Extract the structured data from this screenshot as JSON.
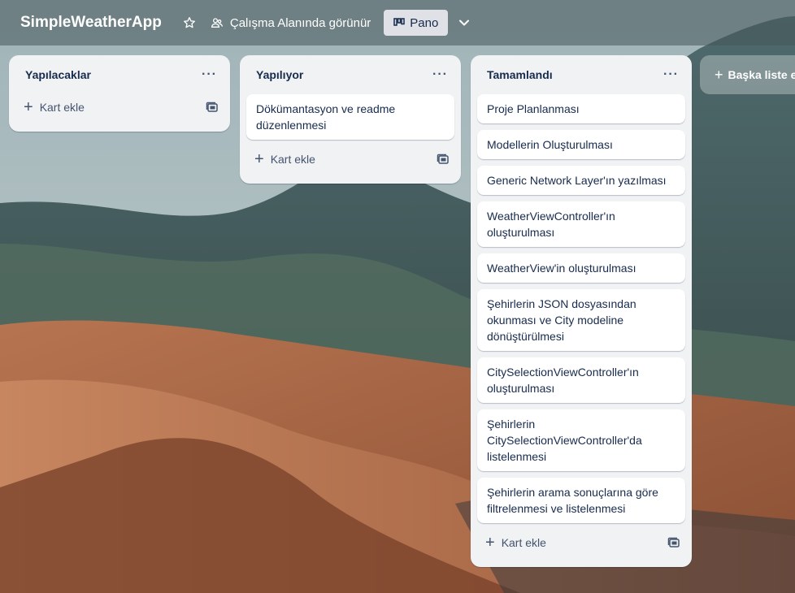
{
  "header": {
    "board_title": "SimpleWeatherApp",
    "visibility_label": "Çalışma Alanında görünür",
    "view_label": "Pano"
  },
  "lists": [
    {
      "title": "Yapılacaklar",
      "cards": [],
      "add_card_label": "Kart ekle"
    },
    {
      "title": "Yapılıyor",
      "cards": [
        "Dökümantasyon ve readme düzenlenmesi"
      ],
      "add_card_label": "Kart ekle"
    },
    {
      "title": "Tamamlandı",
      "cards": [
        "Proje Planlanması",
        "Modellerin Oluşturulması",
        "Generic Network Layer'ın yazılması",
        "WeatherViewController'ın oluşturulması",
        "WeatherView'in oluşturulması",
        "Şehirlerin JSON dosyasından okunması ve City modeline dönüştürülmesi",
        "CitySelectionViewController'ın oluşturulması",
        "Şehirlerin CitySelectionViewController'da listelenmesi",
        "Şehirlerin arama sonuçlarına göre filtrelenmesi ve listelenmesi"
      ],
      "add_card_label": "Kart ekle"
    }
  ],
  "add_list_label": "Başka liste ekle",
  "menu_glyph": "···",
  "colors": {
    "list_bg": "#f1f2f4",
    "card_bg": "#ffffff",
    "text": "#172b4d",
    "view_button_bg": "#dfe1e6"
  }
}
